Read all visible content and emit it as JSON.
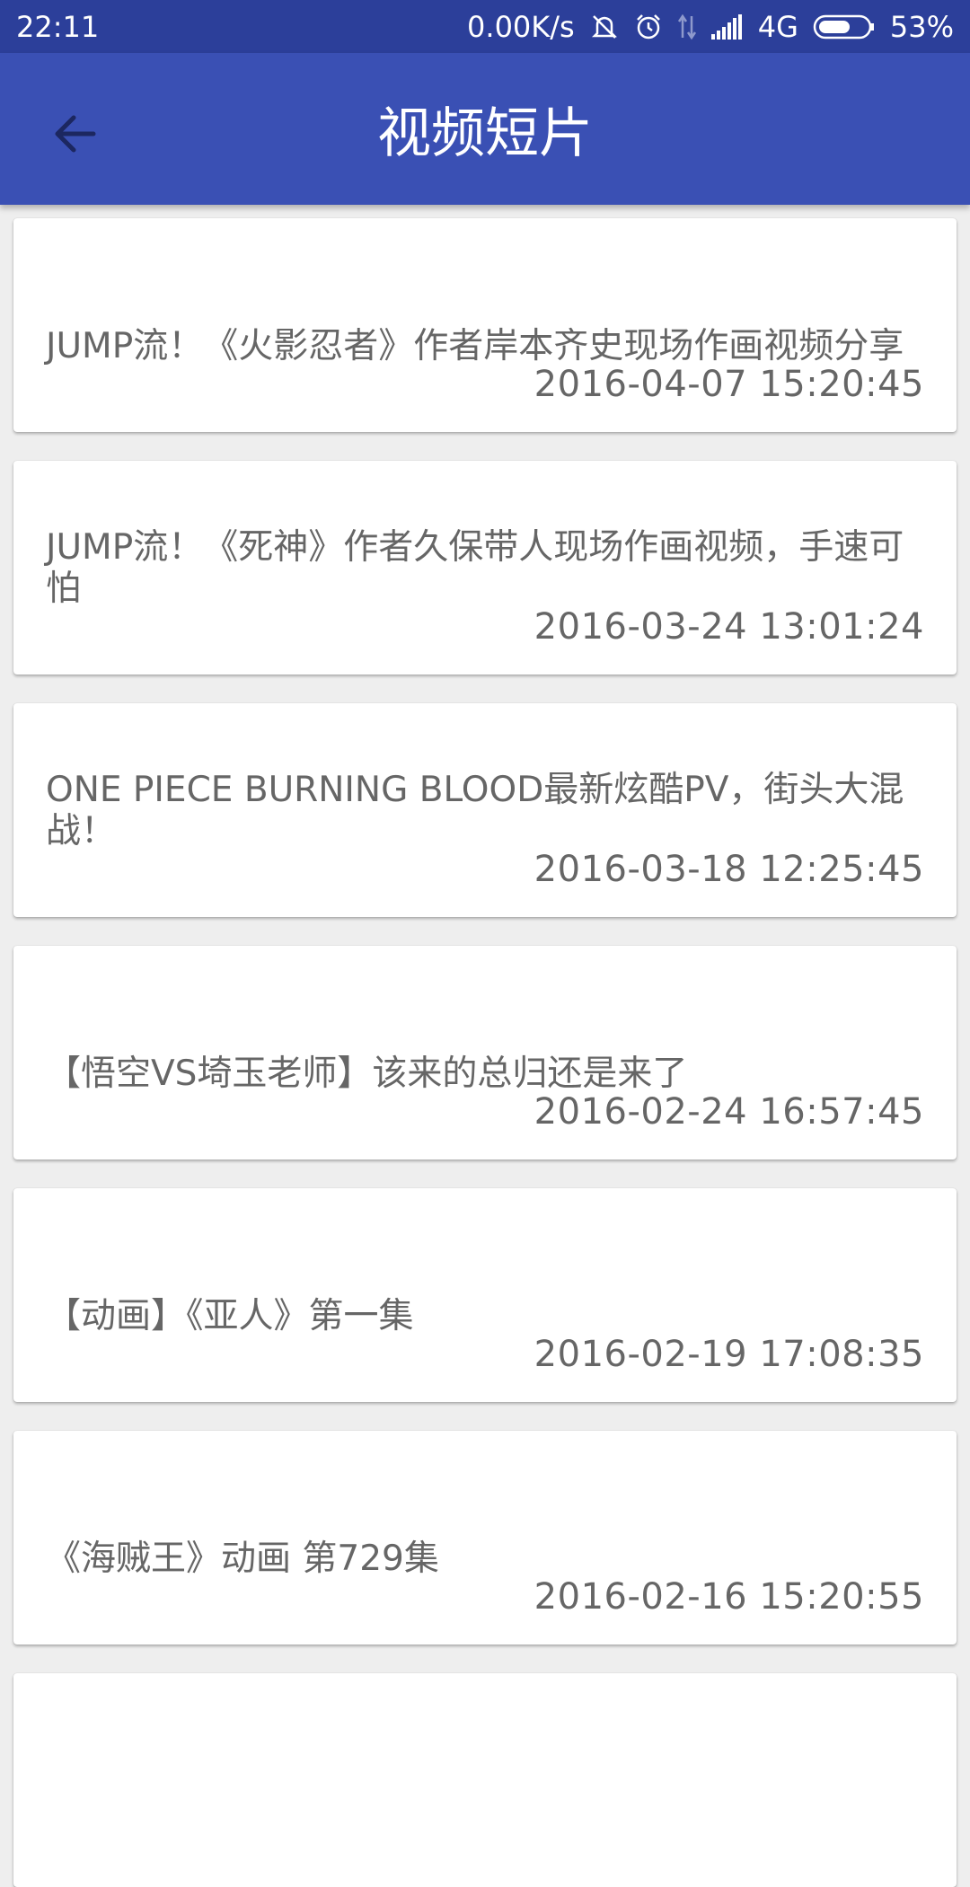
{
  "status_bar": {
    "time": "22:11",
    "speed": "0.00K/s",
    "network": "4G",
    "battery": "53%",
    "icons": [
      "mute-icon",
      "alarm-icon",
      "data-arrows-icon",
      "signal-icon",
      "battery-icon"
    ]
  },
  "app_bar": {
    "title": "视频短片",
    "back_icon": "arrow-back-icon",
    "color": "#3a50b4"
  },
  "items": [
    {
      "title": "JUMP流！《火影忍者》作者岸本齐史现场作画视频分享",
      "date": "2016-04-07 15:20:45"
    },
    {
      "title": "JUMP流！《死神》作者久保带人现场作画视频，手速可怕",
      "date": "2016-03-24 13:01:24"
    },
    {
      "title": "ONE PIECE BURNING BLOOD最新炫酷PV，街头大混战！",
      "date": "2016-03-18 12:25:45"
    },
    {
      "title": "【悟空VS埼玉老师】该来的总归还是来了",
      "date": "2016-02-24 16:57:45"
    },
    {
      "title": "【动画】《亚人》第一集",
      "date": "2016-02-19 17:08:35"
    },
    {
      "title": "《海贼王》动画 第729集",
      "date": "2016-02-16 15:20:55"
    },
    {
      "title": "",
      "date": ""
    }
  ]
}
